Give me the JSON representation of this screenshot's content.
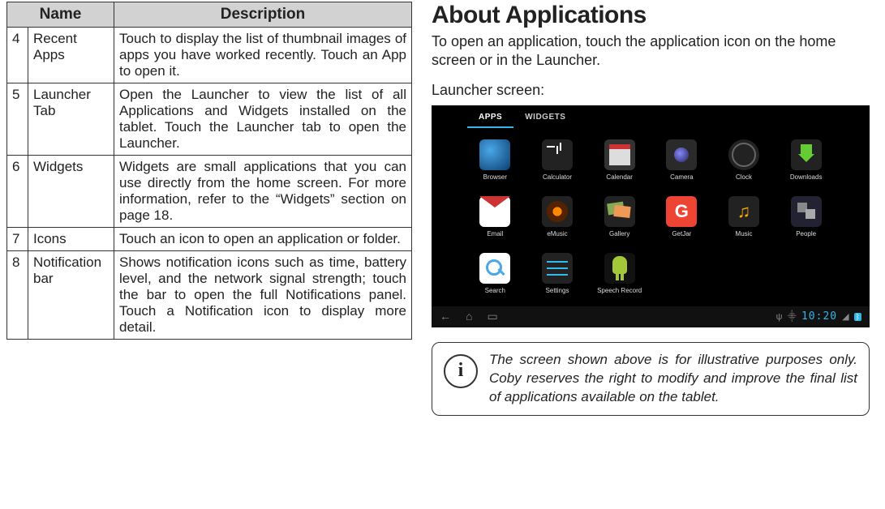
{
  "table": {
    "headers": [
      "Name",
      "Description"
    ],
    "rows": [
      {
        "num": "4",
        "name": "Recent Apps",
        "desc": "Touch to display the list of thumbnail images of apps you have worked recently. Touch an App to open it."
      },
      {
        "num": "5",
        "name": "Launcher Tab",
        "desc": "Open the Launcher to view the list of all Applications and Widgets installed on the tablet. Touch the Launcher tab to open the Launcher."
      },
      {
        "num": "6",
        "name": "Widgets",
        "desc": "Widgets are small applications that you can use directly from the home screen. For more information, refer to the “Widgets” section on page 18."
      },
      {
        "num": "7",
        "name": "Icons",
        "desc": "Touch an icon to open an application or folder."
      },
      {
        "num": "8",
        "name": "Notification bar",
        "desc": "Shows notification icons such as time, battery level, and the network signal strength; touch the bar to open the full Notifications panel. Touch a Notification icon to display more detail."
      }
    ]
  },
  "right": {
    "heading": "About Applications",
    "lead": "To open an application, touch the application icon on the home screen or in the Launcher.",
    "sub": "Launcher screen:",
    "info_glyph": "i",
    "info": "The screen shown above is for illustrative purposes only. Coby reserves the right to modify and improve the final list of applications available on the tablet."
  },
  "launcher": {
    "tabs": [
      {
        "label": "APPS",
        "active": true
      },
      {
        "label": "WIDGETS",
        "active": false
      }
    ],
    "apps": [
      {
        "label": "Browser",
        "cls": "ic-browser"
      },
      {
        "label": "Calculator",
        "cls": "ic-calc"
      },
      {
        "label": "Calendar",
        "cls": "ic-cal"
      },
      {
        "label": "Camera",
        "cls": "ic-cam"
      },
      {
        "label": "Clock",
        "cls": "ic-clock"
      },
      {
        "label": "Downloads",
        "cls": "ic-down"
      },
      {
        "label": "Email",
        "cls": "ic-mail"
      },
      {
        "label": "eMusic",
        "cls": "ic-music"
      },
      {
        "label": "Gallery",
        "cls": "ic-gal"
      },
      {
        "label": "GetJar",
        "cls": "ic-get",
        "glyph": "G"
      },
      {
        "label": "Music",
        "cls": "ic-mus2"
      },
      {
        "label": "People",
        "cls": "ic-ppl"
      },
      {
        "label": "Search",
        "cls": "ic-search"
      },
      {
        "label": "Settings",
        "cls": "ic-set"
      },
      {
        "label": "Speech Record",
        "cls": "ic-rec"
      }
    ],
    "nav": {
      "back": "←",
      "home": "⌂",
      "recent": "▭",
      "usb": "ψ",
      "wifi": "⸎",
      "clock": "10:20",
      "sig": "◢",
      "bt": "ᛒ"
    }
  }
}
